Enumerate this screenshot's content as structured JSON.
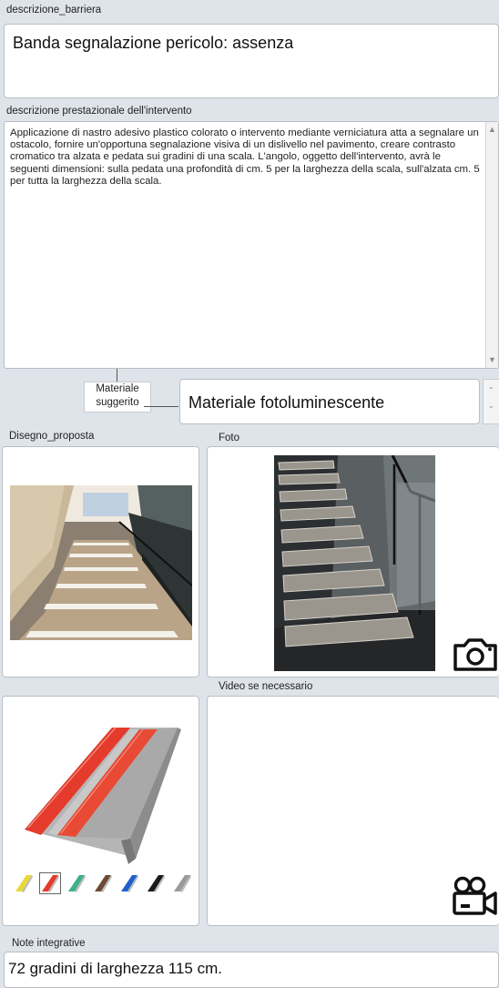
{
  "descrizione_barriera": {
    "label": "descrizione_barriera",
    "value": "Banda segnalazione pericolo: assenza"
  },
  "descrizione_prestazionale": {
    "label": "descrizione prestazionale dell'intervento",
    "value": "Applicazione di nastro adesivo plastico colorato o intervento mediante verniciatura atta a segnalare un ostacolo, fornire un'opportuna segnalazione visiva di un dislivello nel pavimento, creare contrasto cromatico tra alzata e pedata sui gradini di una scala. L'angolo, oggetto dell'intervento, avrà le seguenti dimensioni: sulla pedata una profondità di cm. 5 per la larghezza della scala, sull'alzata cm. 5 per tutta la larghezza della scala."
  },
  "materiale": {
    "label_line1": "Materiale",
    "label_line2": "suggerito",
    "value": "Materiale fotoluminescente"
  },
  "disegno_label": "Disegno_proposta",
  "foto_label": "Foto",
  "video_label": "Video se necessario",
  "note": {
    "label": "Note integrative",
    "value": "72 gradini di larghezza 115 cm."
  },
  "icons": {
    "camera": "camera-icon",
    "video": "video-camera-icon"
  },
  "swatches": [
    "#e8d83a",
    "#e53b2c",
    "#3fae8a",
    "#6b4a33",
    "#1f5fd0",
    "#1a1a1a",
    "#9a9a9a"
  ],
  "selected_swatch": 1
}
